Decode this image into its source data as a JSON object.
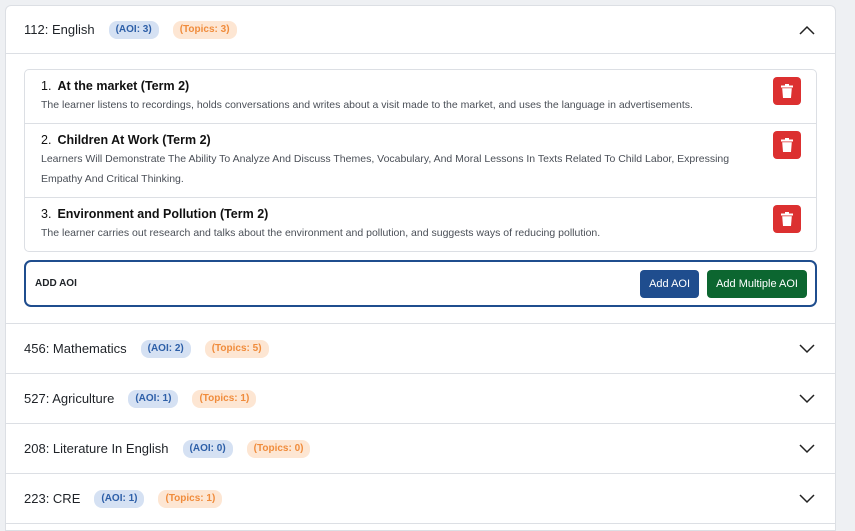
{
  "subjects": [
    {
      "title": "112: English",
      "aoi_badge": "(AOI: 3)",
      "topics_badge": "(Topics: 3)",
      "expanded": true,
      "aois": [
        {
          "num": "1.",
          "title": "At the market (Term 2)",
          "desc": "The learner listens to recordings, holds conversations and writes about a visit made to the market, and uses the language in advertisements."
        },
        {
          "num": "2.",
          "title": "Children At Work (Term 2)",
          "desc": "Learners Will Demonstrate The Ability To Analyze And Discuss Themes, Vocabulary, And Moral Lessons In Texts Related To Child Labor, Expressing Empathy And Critical Thinking."
        },
        {
          "num": "3.",
          "title": "Environment and Pollution (Term 2)",
          "desc": "The learner carries out research and talks about the environment and pollution, and suggests ways of reducing pollution."
        }
      ]
    },
    {
      "title": "456: Mathematics",
      "aoi_badge": "(AOI: 2)",
      "topics_badge": "(Topics: 5)"
    },
    {
      "title": "527: Agriculture",
      "aoi_badge": "(AOI: 1)",
      "topics_badge": "(Topics: 1)"
    },
    {
      "title": "208: Literature In English",
      "aoi_badge": "(AOI: 0)",
      "topics_badge": "(Topics: 0)"
    },
    {
      "title": "223: CRE",
      "aoi_badge": "(AOI: 1)",
      "topics_badge": "(Topics: 1)"
    }
  ],
  "add_aoi": {
    "label": "ADD AOI",
    "add_button": "Add AOI",
    "add_multiple_button": "Add Multiple AOI"
  },
  "icons": {
    "collapse": "chevron-up-icon",
    "expand": "chevron-down-icon",
    "delete": "trash-icon"
  },
  "colors": {
    "aoi_badge_bg": "#d5e1f3",
    "topics_badge_bg": "#fde6d3",
    "delete": "#dc3030",
    "primary": "#1f4d8e",
    "success": "#0c6630"
  }
}
